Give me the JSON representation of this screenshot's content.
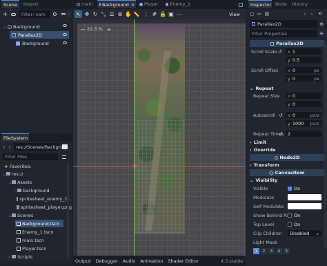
{
  "left_dock": {
    "tabs": [
      "Scene",
      "Import"
    ],
    "filter_placeholder": "Filter: nam",
    "tree": [
      {
        "label": "Background",
        "icon": "node2d-icon"
      },
      {
        "label": "Parallax2D",
        "icon": "parallax-icon"
      },
      {
        "label": "Background",
        "icon": "sprite-icon"
      }
    ]
  },
  "filesystem": {
    "tab": "FileSystem",
    "path": "res://Scenes/Backgrou",
    "filter_placeholder": "Filter Files",
    "items": [
      {
        "label": "Favorites:"
      },
      {
        "label": "res://"
      },
      {
        "label": "Assets"
      },
      {
        "label": "background"
      },
      {
        "label": "spritesheet_enemy_1..."
      },
      {
        "label": "spritesheet_player.png"
      },
      {
        "label": "Scenes"
      },
      {
        "label": "Background.tscn"
      },
      {
        "label": "Enemy_1.tscn"
      },
      {
        "label": "main.tscn"
      },
      {
        "label": "Player.tscn"
      },
      {
        "label": "Scripts"
      }
    ]
  },
  "scene_tabs": [
    "main",
    "Background",
    "Player",
    "Enemy_1"
  ],
  "toolbar": {
    "view_label": "View",
    "zoom": "22.3 %"
  },
  "bottom_tabs": [
    "Output",
    "Debugger",
    "Audio",
    "Animation",
    "Shader Editor"
  ],
  "version": "4.3.stable",
  "inspector": {
    "tabs": [
      "Inspector",
      "Node",
      "History"
    ],
    "node_name": "Parallax2D",
    "filter_placeholder": "Filter Properties",
    "header_class": "Parallax2D",
    "scroll_scale": {
      "label": "Scroll Scale",
      "x": "1",
      "y": "0.5"
    },
    "scroll_offset": {
      "label": "Scroll Offset",
      "x": "0",
      "y": "0",
      "unit": "px"
    },
    "repeat_section": "Repeat",
    "repeat_size": {
      "label": "Repeat Size",
      "x": "0",
      "y": "0"
    },
    "autoscroll": {
      "label": "Autoscroll",
      "x": "0",
      "y": "1000",
      "unit": "px/s"
    },
    "repeat_times": {
      "label": "Repeat Times",
      "value": "2"
    },
    "limit_section": "Limit",
    "override_section": "Override",
    "node2d_header": "Node2D",
    "transform_section": "Transform",
    "canvasitem_header": "CanvasItem",
    "visibility_section": "Visibility",
    "visible": {
      "label": "Visible",
      "value": "On"
    },
    "modulate_label": "Modulate",
    "self_modulate_label": "Self Modulate",
    "show_behind": {
      "label": "Show Behind Par",
      "value": "On"
    },
    "top_level": {
      "label": "Top Level",
      "value": "On"
    },
    "clip_children": {
      "label": "Clip Children",
      "value": "Disabled"
    },
    "light_mask_label": "Light Mask",
    "light_mask_values": [
      "1",
      "2",
      "3",
      "4",
      "5"
    ],
    "accent": "#4f8ee8"
  }
}
